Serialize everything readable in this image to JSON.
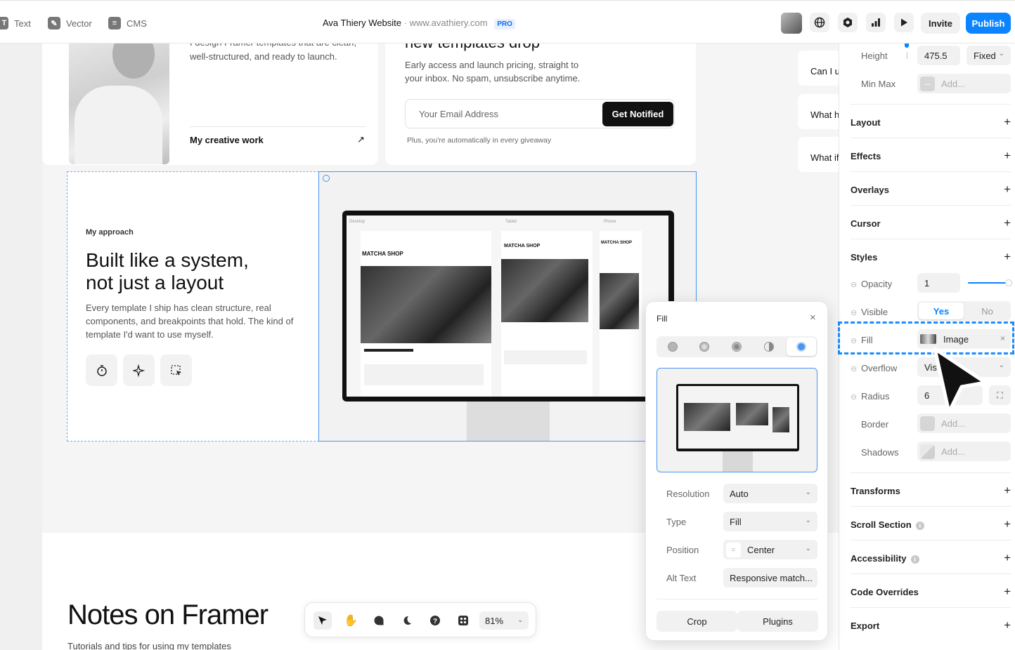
{
  "toolbar": {
    "tools": [
      {
        "label": "Text",
        "icon": "text-icon"
      },
      {
        "label": "Vector",
        "icon": "pen-icon"
      },
      {
        "label": "CMS",
        "icon": "database-icon"
      }
    ],
    "site_name": "Ava Thiery Website",
    "separator": "·",
    "site_url": "www.avathiery.com",
    "plan_badge": "PRO",
    "invite_label": "Invite",
    "publish_label": "Publish"
  },
  "canvas": {
    "intro_partial": "I design Framer templates that are clean,",
    "intro_rest": "well-structured, and ready to launch.",
    "creative_link": "My creative work",
    "creative_arrow": "↗",
    "newsletter_heading_partial": "new templates drop",
    "newsletter_body": "Early access and launch pricing, straight to your inbox. No spam, unsubscribe anytime.",
    "email_placeholder": "Your Email Address",
    "notify_button": "Get Notified",
    "giveaway_note": "Plus, you're automatically in every giveaway",
    "approach_label": "My approach",
    "approach_title_line1": "Built like a system,",
    "approach_title_line2": "not just a layout",
    "approach_body": "Every template I ship has clean structure, real components, and breakpoints that hold. The kind of template I'd want to use myself.",
    "notes_title": "Notes on Framer",
    "notes_subtitle": "Tutorials and tips for using my templates",
    "faq_items": [
      "Can I u",
      "What h",
      "What if"
    ],
    "mockup": {
      "columns": [
        "Desktop",
        "Tablet",
        "Phone"
      ],
      "shop_title": "MATCHA SHOP"
    }
  },
  "bottom_toolbar": {
    "zoom": "81%"
  },
  "panel": {
    "height_label": "Height",
    "height_value": "475.5",
    "height_mode": "Fixed",
    "minmax_label": "Min Max",
    "minmax_placeholder": "Add...",
    "sections_top": [
      "Layout",
      "Effects",
      "Overlays",
      "Cursor",
      "Styles"
    ],
    "opacity_label": "Opacity",
    "opacity_value": "1",
    "visible_label": "Visible",
    "visible_yes": "Yes",
    "visible_no": "No",
    "fill_label": "Fill",
    "fill_value": "Image",
    "overflow_label": "Overflow",
    "overflow_value": "Vis",
    "radius_label": "Radius",
    "radius_value": "6",
    "border_label": "Border",
    "border_placeholder": "Add...",
    "shadows_label": "Shadows",
    "shadows_placeholder": "Add...",
    "sections_bottom": [
      {
        "label": "Transforms",
        "info": false
      },
      {
        "label": "Scroll Section",
        "info": true
      },
      {
        "label": "Accessibility",
        "info": true
      },
      {
        "label": "Code Overrides",
        "info": false
      },
      {
        "label": "Export",
        "info": false
      }
    ],
    "plus": "+"
  },
  "fill_popover": {
    "title": "Fill",
    "close": "×",
    "resolution_label": "Resolution",
    "resolution_value": "Auto",
    "type_label": "Type",
    "type_value": "Fill",
    "position_label": "Position",
    "position_value": "Center",
    "alt_label": "Alt Text",
    "alt_value": "Responsive match...",
    "crop_label": "Crop",
    "plugins_label": "Plugins"
  },
  "colors": {
    "accent": "#0a84ff",
    "selection": "#4a95f0",
    "highlight_dashed": "#1a8cff"
  }
}
